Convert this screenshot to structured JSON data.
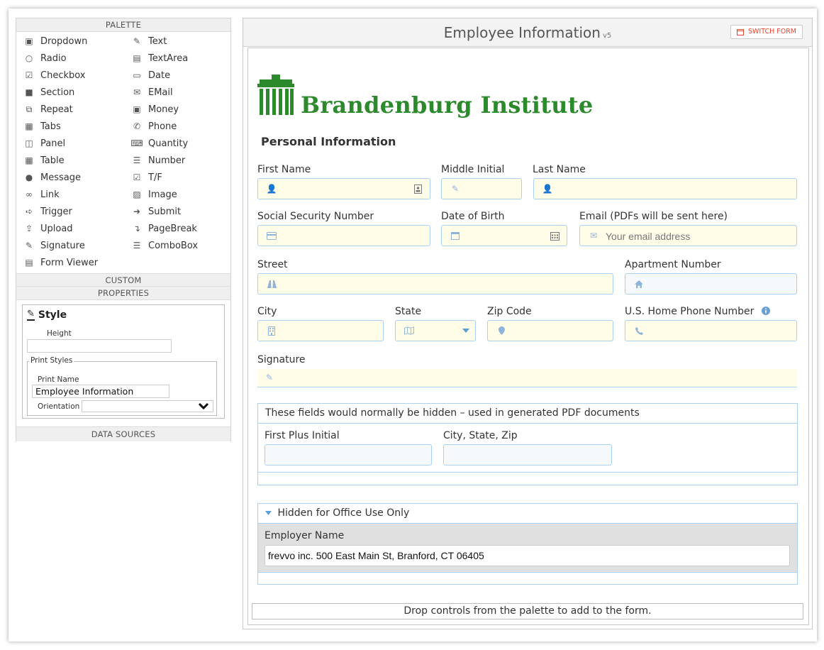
{
  "palette": {
    "header": "PALETTE",
    "col1": [
      {
        "label": "Dropdown",
        "icon": "dropdown-icon"
      },
      {
        "label": "Radio",
        "icon": "radio-icon"
      },
      {
        "label": "Checkbox",
        "icon": "checkbox-icon"
      },
      {
        "label": "Section",
        "icon": "folder-icon"
      },
      {
        "label": "Repeat",
        "icon": "repeat-icon"
      },
      {
        "label": "Tabs",
        "icon": "tabs-icon"
      },
      {
        "label": "Panel",
        "icon": "panel-icon"
      },
      {
        "label": "Table",
        "icon": "table-icon"
      },
      {
        "label": "Message",
        "icon": "message-icon"
      },
      {
        "label": "Link",
        "icon": "link-icon"
      },
      {
        "label": "Trigger",
        "icon": "trigger-icon"
      },
      {
        "label": "Upload",
        "icon": "upload-icon"
      },
      {
        "label": "Signature",
        "icon": "signature-icon"
      },
      {
        "label": "Form Viewer",
        "icon": "book-icon"
      }
    ],
    "col2": [
      {
        "label": "Text",
        "icon": "text-icon"
      },
      {
        "label": "TextArea",
        "icon": "textarea-icon"
      },
      {
        "label": "Date",
        "icon": "calendar-icon"
      },
      {
        "label": "EMail",
        "icon": "email-icon"
      },
      {
        "label": "Money",
        "icon": "money-icon"
      },
      {
        "label": "Phone",
        "icon": "phone-icon"
      },
      {
        "label": "Quantity",
        "icon": "keyboard-icon"
      },
      {
        "label": "Number",
        "icon": "number-list-icon"
      },
      {
        "label": "T/F",
        "icon": "check-square-icon"
      },
      {
        "label": "Image",
        "icon": "image-icon"
      },
      {
        "label": "Submit",
        "icon": "submit-icon"
      },
      {
        "label": "PageBreak",
        "icon": "pagebreak-icon"
      },
      {
        "label": "ComboBox",
        "icon": "combobox-icon"
      }
    ]
  },
  "custom_header": "CUSTOM",
  "properties": {
    "header": "PROPERTIES",
    "style_title": "Style",
    "height_label": "Height",
    "height_value": "",
    "print_styles_legend": "Print Styles",
    "print_name_label": "Print Name",
    "print_name_value": "Employee Information",
    "orientation_label": "Orientation",
    "orientation_value": ""
  },
  "data_sources_header": "DATA SOURCES",
  "form": {
    "title": "Employee Information",
    "version": "v5",
    "switch_label": "SWITCH FORM",
    "logo_text": "Brandenburg Institute",
    "section_title": "Personal Information",
    "fields": {
      "first_name": "First Name",
      "middle_initial": "Middle Initial",
      "last_name": "Last Name",
      "ssn": "Social Security Number",
      "dob": "Date of Birth",
      "email": "Email (PDFs will be sent here)",
      "email_placeholder": "Your email address",
      "street": "Street",
      "apartment": "Apartment Number",
      "city": "City",
      "state": "State",
      "zip": "Zip Code",
      "phone": "U.S. Home Phone Number",
      "signature": "Signature"
    },
    "hidden_box": {
      "title": "These fields would normally be hidden – used in generated PDF documents",
      "first_plus_initial": "First Plus Initial",
      "city_state_zip": "City, State, Zip"
    },
    "office_box": {
      "title": "Hidden for Office Use Only",
      "employer_label": "Employer Name",
      "employer_value": "frevvo inc. 500 East Main St, Branford, CT 06405"
    },
    "dropzone": "Drop controls from the palette to add to the form."
  },
  "colors": {
    "accent_green": "#2c8a2c",
    "field_yellow": "#fffde8",
    "field_border": "#a9d0f5",
    "switch_red": "#e2452d"
  }
}
